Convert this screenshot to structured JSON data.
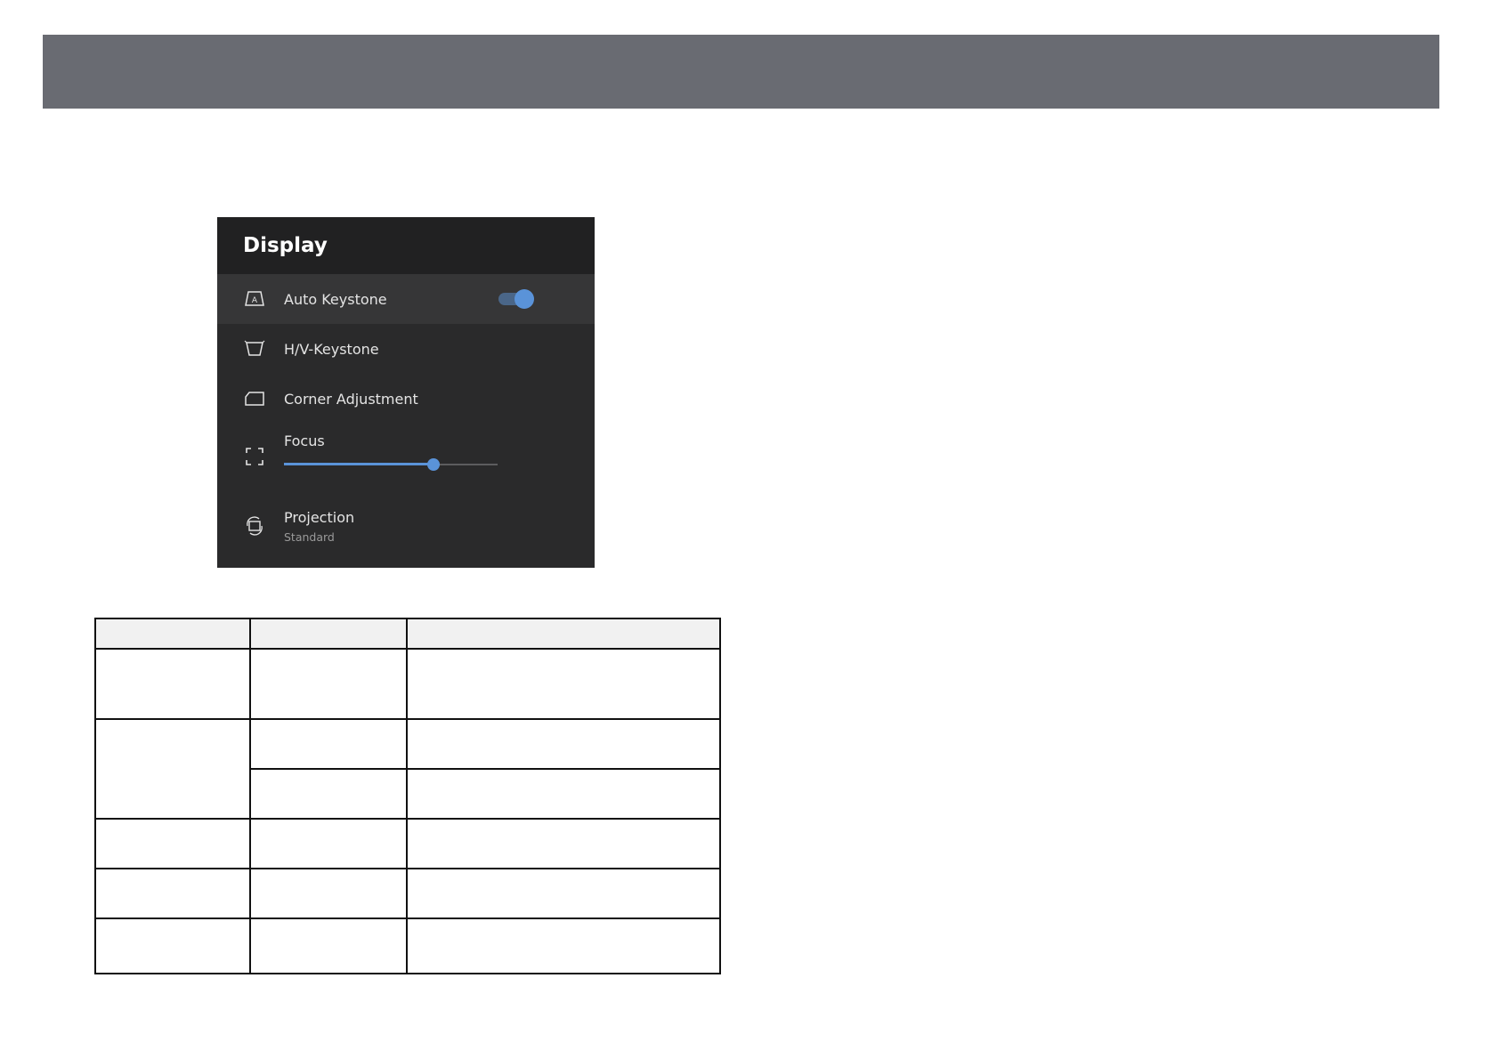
{
  "panel": {
    "title": "Display",
    "items": [
      {
        "label": "Auto Keystone",
        "icon": "auto-keystone-icon",
        "toggle_on": true
      },
      {
        "label": "H/V-Keystone",
        "icon": "hv-keystone-icon"
      },
      {
        "label": "Corner Adjustment",
        "icon": "corner-adjustment-icon"
      },
      {
        "label": "Focus",
        "icon": "focus-icon",
        "slider_value": 0.7
      },
      {
        "label": "Projection",
        "icon": "projection-icon",
        "sublabel": "Standard"
      }
    ]
  },
  "colors": {
    "banner": "#696b72",
    "panel_bg": "#2a2a2b",
    "accent": "#5a93d9"
  },
  "table": {
    "rows": 6,
    "columns": 3
  }
}
